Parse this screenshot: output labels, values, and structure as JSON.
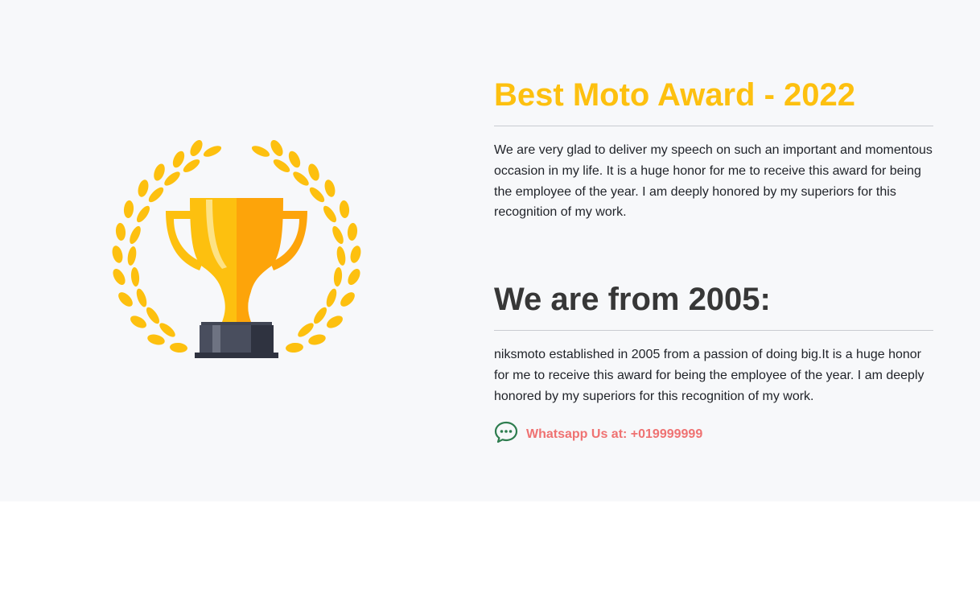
{
  "award": {
    "title": "Best Moto Award - 2022",
    "description": "We are very glad to deliver my speech on such an important and momentous occasion in my life. It is a huge honor for me to receive this award for being the employee of the year. I am deeply honored by my superiors for this recognition of my work."
  },
  "history": {
    "title": "We are from 2005:",
    "description": "niksmoto established in 2005 from a passion of doing big.It is a huge honor for me to receive this award for being the employee of the year. I am deeply honored by my superiors for this recognition of my work."
  },
  "contact": {
    "whatsapp_label": "Whatsapp Us at: +019999999",
    "icon": "chat-bubble-icon"
  },
  "colors": {
    "accent_gold": "#fdc00f",
    "heading_dark": "#373737",
    "whatsapp_text": "#ef7272",
    "whatsapp_icon": "#2e7d4f",
    "section_bg": "#f7f8fa"
  }
}
